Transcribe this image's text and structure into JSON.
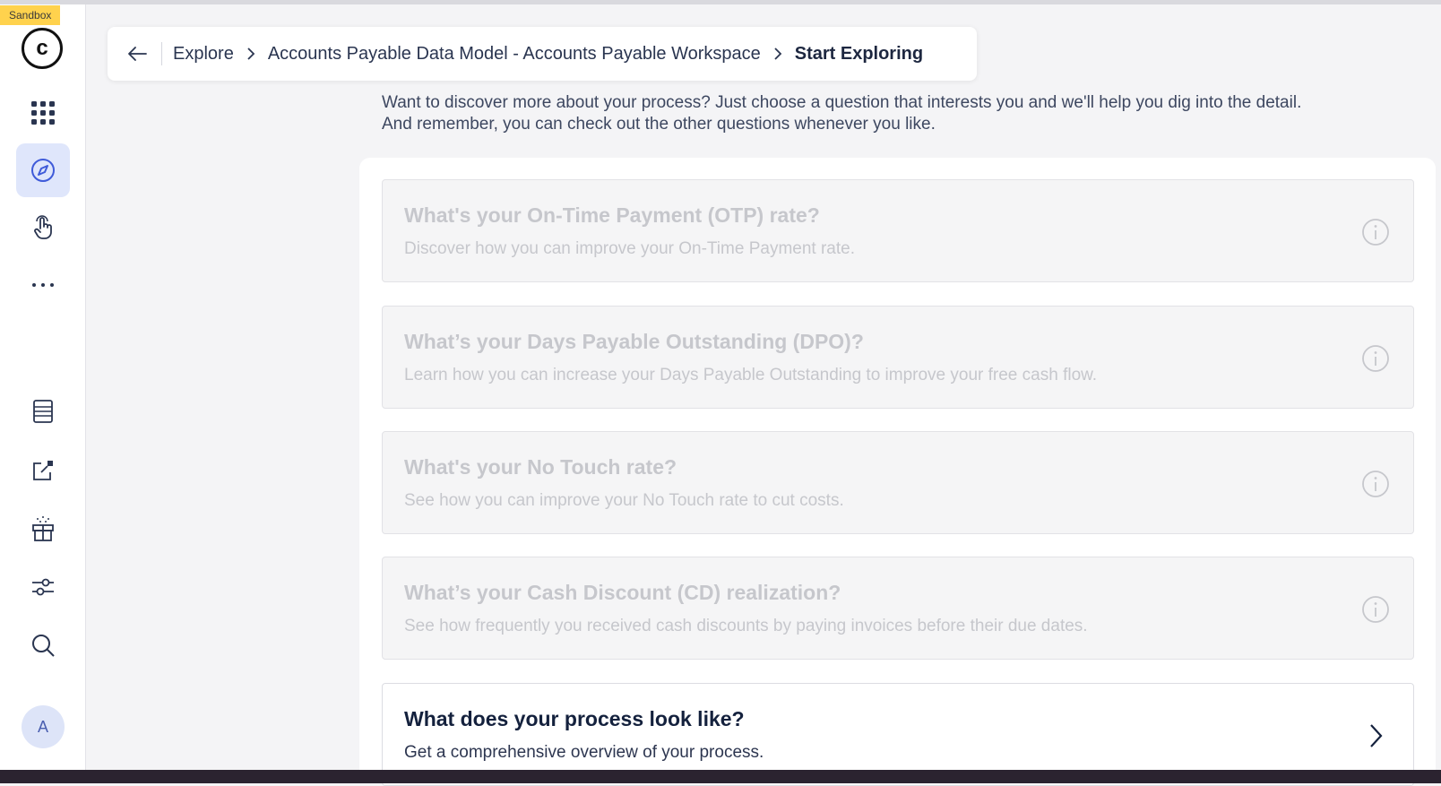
{
  "environment_badge": "Sandbox",
  "sidebar": {
    "logo_letter": "c",
    "avatar_letter": "A",
    "items": [
      {
        "name": "apps-grid-icon",
        "active": false
      },
      {
        "name": "compass-icon",
        "active": true
      },
      {
        "name": "hand-pointer-icon",
        "active": false
      },
      {
        "name": "more-icon",
        "active": false
      },
      {
        "name": "data-table-icon",
        "active": false
      },
      {
        "name": "external-link-icon",
        "active": false
      },
      {
        "name": "gift-icon",
        "active": false
      },
      {
        "name": "sliders-icon",
        "active": false
      },
      {
        "name": "search-icon",
        "active": false
      }
    ],
    "accent_color": "#3f5bd9"
  },
  "breadcrumb": {
    "items": [
      "Explore",
      "Accounts Payable Data Model - Accounts Payable Workspace"
    ],
    "current": "Start Exploring"
  },
  "intro": {
    "line1": "Want to discover more about your process? Just choose a question that interests you and we'll help you dig into the detail.",
    "line2": "And remember, you can check out the other questions whenever you like."
  },
  "questions": [
    {
      "title": "What's your On-Time Payment (OTP) rate?",
      "description": "Discover how you can improve your On-Time Payment rate.",
      "enabled": false,
      "icon": "info-icon"
    },
    {
      "title": "What’s your Days Payable Outstanding (DPO)?",
      "description": "Learn how you can increase your Days Payable Outstanding to improve your free cash flow.",
      "enabled": false,
      "icon": "info-icon"
    },
    {
      "title": "What's your No Touch rate?",
      "description": "See how you can improve your No Touch rate to cut costs.",
      "enabled": false,
      "icon": "info-icon"
    },
    {
      "title": "What’s your Cash Discount (CD) realization?",
      "description": "See how frequently you received cash discounts by paying invoices before their due dates.",
      "enabled": false,
      "icon": "info-icon"
    },
    {
      "title": "What does your process look like?",
      "description": "Get a comprehensive overview of your process.",
      "enabled": true,
      "icon": "chevron-right-icon"
    }
  ]
}
